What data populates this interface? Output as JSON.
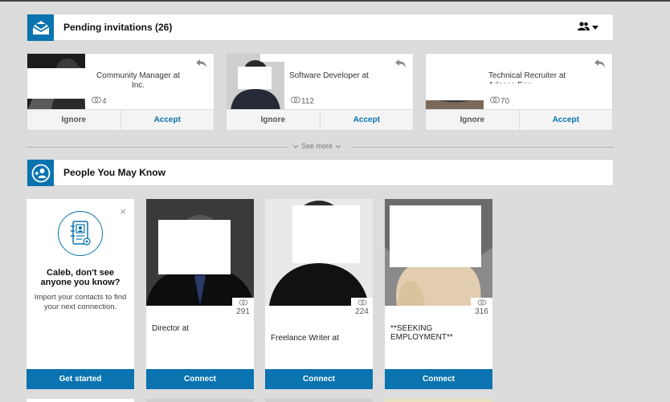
{
  "pending": {
    "title": "Pending invitations (26)",
    "invitations": [
      {
        "headline": "Community Manager at Inc.",
        "connections": "4",
        "ignore_label": "Ignore",
        "accept_label": "Accept"
      },
      {
        "headline": "Software Developer at",
        "connections": "112",
        "ignore_label": "Ignore",
        "accept_label": "Accept"
      },
      {
        "headline": "Technical Recruiter at Adecco Eng",
        "connections": "70",
        "ignore_label": "Ignore",
        "accept_label": "Accept"
      }
    ],
    "see_more_label": "See more"
  },
  "pymk": {
    "title": "People You May Know",
    "intro": {
      "heading": "Caleb, don't see anyone you know?",
      "sub": "Import your contacts to find your next connection.",
      "button": "Get started",
      "close": "×"
    },
    "people": [
      {
        "headline": "Director at",
        "connections": "291",
        "button": "Connect"
      },
      {
        "headline": "Freelance Writer at",
        "connections": "224",
        "button": "Connect"
      },
      {
        "headline": "**SEEKING EMPLOYMENT**",
        "connections": "316",
        "button": "Connect"
      }
    ]
  },
  "colors": {
    "accent": "#0a73b0",
    "background": "#dcdcdc",
    "card": "#ffffff"
  },
  "icons": [
    "envelope-open-icon",
    "people-icon",
    "caret-down-icon",
    "reply-icon",
    "connections-icon",
    "add-contact-icon",
    "address-book-icon",
    "close-icon",
    "chevron-down-icon"
  ]
}
